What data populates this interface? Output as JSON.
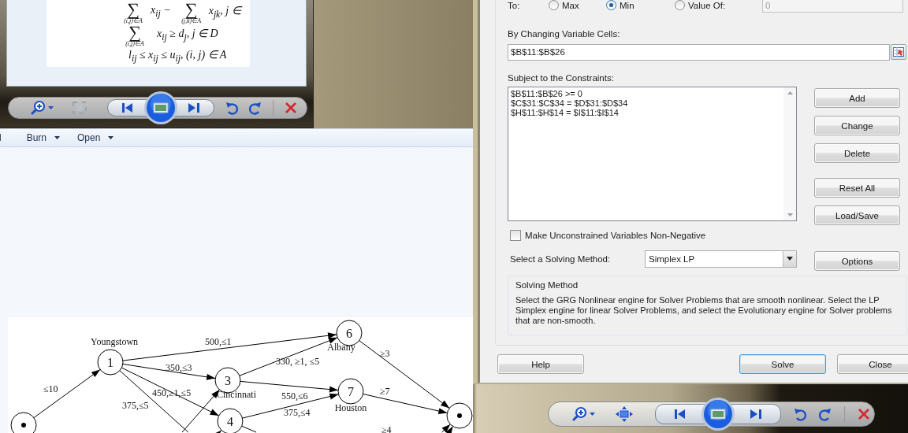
{
  "photo_viewer": {
    "formula": [
      {
        "terms": [
          {
            "sign": "∑",
            "range": "(i,j)∈A",
            "expr": "x$_{ij}$ −"
          },
          {
            "sign": "∑",
            "range": "(j,k)∈A",
            "expr": "x$_{jk}$, j ∈"
          }
        ]
      },
      {
        "terms": [
          {
            "sign": "∑",
            "range": "(i,j)∈A",
            "expr": "x$_{ij}$ ≥ d$_{j}$, j ∈ D"
          }
        ]
      },
      {
        "terms": [
          {
            "expr": "l$_{ij}$ ≤ x$_{ij}$ ≤ u$_{ij}$, (i, j) ∈ A"
          }
        ]
      }
    ]
  },
  "explorer": {
    "toolbar": [
      {
        "label": "l",
        "dropdown": false
      },
      {
        "label": "Burn",
        "dropdown": true
      },
      {
        "label": "Open",
        "dropdown": true
      }
    ],
    "graph": {
      "nodes": [
        {
          "kind": "terminal"
        },
        {
          "kind": "node",
          "label": "1",
          "name": "Youngstown"
        },
        {
          "kind": "node",
          "label": "3",
          "name": "Cincinnati"
        },
        {
          "kind": "node",
          "label": "4"
        },
        {
          "kind": "node",
          "label": "6",
          "name": "Albany"
        },
        {
          "kind": "node",
          "label": "7",
          "name": "Houston"
        },
        {
          "kind": "terminal"
        }
      ],
      "edge_labels": [
        "≤10",
        "500,≤1",
        "350,≤3",
        "450,≥1,≤5",
        "375,≤5",
        "330, ≥1, ≤5",
        "550,≤6",
        "375,≤4",
        "≥3",
        "≥7",
        "≥4"
      ]
    }
  },
  "solver": {
    "to_label": "To:",
    "objective": [
      {
        "label": "Max",
        "selected": false
      },
      {
        "label": "Min",
        "selected": true
      },
      {
        "label": "Value Of:",
        "selected": false
      }
    ],
    "value_of": "0",
    "changing_label": "By Changing Variable Cells:",
    "changing_value": "$B$11:$B$26",
    "constraints_label": "Subject to the Constraints:",
    "constraints": [
      "$B$11:$B$26 >= 0",
      "$C$31:$C$34 = $D$31:$D$34",
      "$H$11:$H$14 = $I$11:$I$14"
    ],
    "side_buttons": [
      "Add",
      "Change",
      "Delete",
      "Reset All",
      "Load/Save"
    ],
    "nonneg": {
      "label": "Make Unconstrained Variables Non-Negative",
      "checked": false
    },
    "method_label": "Select a Solving Method:",
    "method": "Simplex LP",
    "options_button": "Options",
    "group": {
      "title": "Solving Method",
      "text": "Select the GRG Nonlinear engine for Solver Problems that are smooth nonlinear. Select the LP Simplex engine for linear Solver Problems, and select the Evolutionary engine for Solver problems that are non-smooth."
    },
    "footer_buttons": [
      {
        "label": "Help",
        "default": false
      },
      {
        "label": "Solve",
        "default": true
      },
      {
        "label": "Close",
        "default": false
      }
    ]
  }
}
